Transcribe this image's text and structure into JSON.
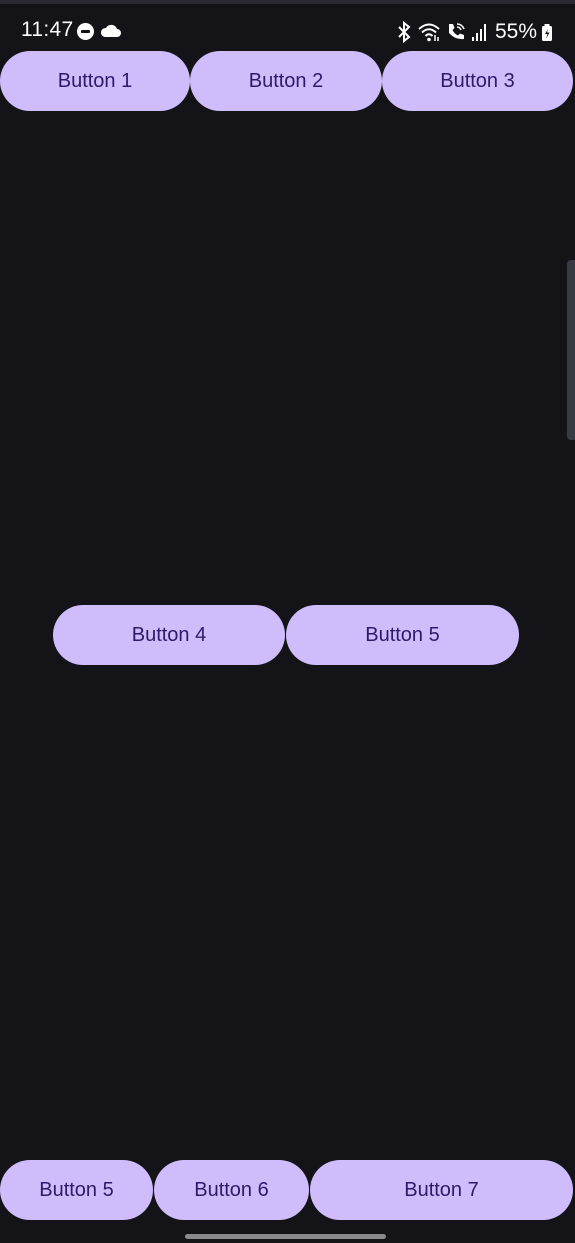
{
  "status_bar": {
    "time": "11:47",
    "battery": "55%",
    "icons": [
      "do-not-disturb-icon",
      "cloud-icon",
      "bluetooth-icon",
      "wifi-icon",
      "wifi-calling-icon",
      "signal-icon",
      "battery-icon"
    ]
  },
  "colors": {
    "background": "#131318",
    "button_fill": "#cfbdfb",
    "button_text": "#2e1a6b"
  },
  "top_row": {
    "buttons": [
      {
        "label": "Button 1"
      },
      {
        "label": "Button 2"
      },
      {
        "label": "Button 3"
      }
    ]
  },
  "middle_row": {
    "buttons": [
      {
        "label": "Button 4"
      },
      {
        "label": "Button 5"
      }
    ]
  },
  "bottom_row": {
    "buttons": [
      {
        "label": "Button 5"
      },
      {
        "label": "Button 6"
      },
      {
        "label": "Button 7"
      }
    ]
  }
}
